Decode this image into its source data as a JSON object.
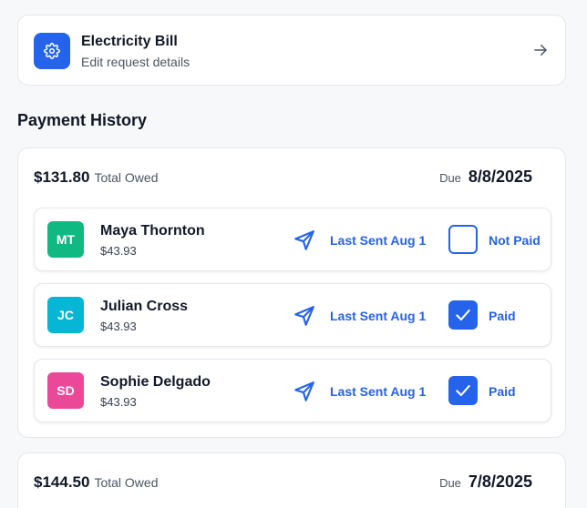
{
  "request": {
    "title": "Electricity Bill",
    "subtitle": "Edit request details",
    "icon": "gear-icon",
    "action_icon": "arrow-right-icon"
  },
  "history": {
    "title": "Payment History",
    "groups": [
      {
        "total_amount": "$131.80",
        "total_label": "Total Owed",
        "due_label": "Due",
        "due_date": "8/8/2025",
        "people": [
          {
            "initials": "MT",
            "name": "Maya Thornton",
            "amount": "$43.93",
            "last_sent": "Last Sent Aug 1",
            "status": "Not Paid",
            "paid": false,
            "avatar_color": "#10b981"
          },
          {
            "initials": "JC",
            "name": "Julian Cross",
            "amount": "$43.93",
            "last_sent": "Last Sent Aug 1",
            "status": "Paid",
            "paid": true,
            "avatar_color": "#06b6d4"
          },
          {
            "initials": "SD",
            "name": "Sophie Delgado",
            "amount": "$43.93",
            "last_sent": "Last Sent Aug 1",
            "status": "Paid",
            "paid": true,
            "avatar_color": "#ec4899"
          }
        ]
      },
      {
        "total_amount": "$144.50",
        "total_label": "Total Owed",
        "due_label": "Due",
        "due_date": "7/8/2025"
      }
    ]
  },
  "colors": {
    "accent": "#2563eb",
    "card_border": "#e5e7eb",
    "background": "#f7f8fa"
  }
}
